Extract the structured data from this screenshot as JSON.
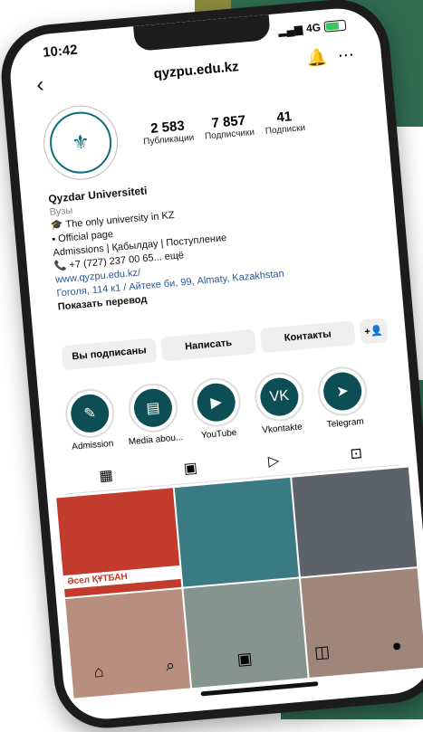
{
  "status": {
    "time": "10:42",
    "network": "4G"
  },
  "header": {
    "handle": "qyzpu.edu.kz"
  },
  "stats": [
    {
      "value": "2 583",
      "label": "Публикации"
    },
    {
      "value": "7 857",
      "label": "Подписчики"
    },
    {
      "value": "41",
      "label": "Подписки"
    }
  ],
  "bio": {
    "name": "Qyzdar Universiteti",
    "category": "Вузы",
    "line1": "🎓 The only university in KZ",
    "line2": "▪ Official page",
    "line3": "Admissions | Қабылдау | Поступление",
    "phone": "📞 +7 (727) 237 00 65... ещё",
    "website": "www.qyzpu.edu.kz/",
    "address": "Гоголя, 114 к1 / Айтеке би, 99, Almaty, Kazakhstan",
    "translate": "Показать перевод"
  },
  "buttons": {
    "following": "Вы подписаны",
    "message": "Написать",
    "contacts": "Контакты",
    "add_person": "+👤"
  },
  "highlights": [
    {
      "label": "Admission",
      "icon": "✎"
    },
    {
      "label": "Media abou...",
      "icon": "▤"
    },
    {
      "label": "YouTube",
      "icon": "▶"
    },
    {
      "label": "Vkontakte",
      "icon": "VK"
    },
    {
      "label": "Telegram",
      "icon": "➤"
    }
  ],
  "tabs": [
    "▦",
    "▣",
    "▷",
    "⊡"
  ],
  "nav": [
    "⌂",
    "⌕",
    "▣",
    "◫",
    "●"
  ],
  "post_caption": "Әсел ҚҰТБАН"
}
